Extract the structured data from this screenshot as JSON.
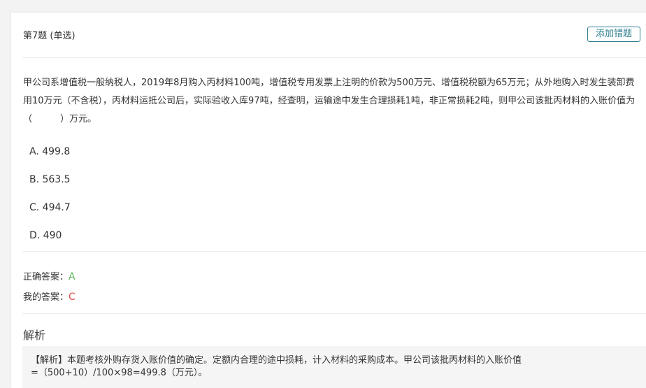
{
  "question": {
    "number_label": "第7题 (单选)",
    "add_wrong_button": "添加错题",
    "stem_part1": "甲公司系增值税一般纳税人，2019年8月购入丙材料100吨，增值税专用发票上注明的价款为500万元、增值税税额为65万元；从外地购入时发生装卸费用10万元（不含税），丙材料运抵公司后，实际验收入库97吨，经查明，运输途中发生合理损耗1吨，非正常损耗2吨，则甲公司该批丙材料的入账价值为（",
    "stem_part2": "）万元。",
    "options": [
      {
        "label": "A. 499.8"
      },
      {
        "label": "B. 563.5"
      },
      {
        "label": "C. 494.7"
      },
      {
        "label": "D. 490"
      }
    ]
  },
  "answers": {
    "correct_label": "正确答案：",
    "correct_value": "A",
    "mine_label": "我的答案：",
    "mine_value": "C"
  },
  "analysis": {
    "title": "解析",
    "line1": "【解析】本题考核外购存货入账价值的确定。定额内合理的途中损耗，计入材料的采购成本。甲公司该批丙材料的入账价值",
    "line2": "=（500+10）/100×98=499.8（万元）。"
  },
  "colors": {
    "accent": "#2e7f8f",
    "correct": "#5cb85c",
    "mine": "#d9534f"
  }
}
